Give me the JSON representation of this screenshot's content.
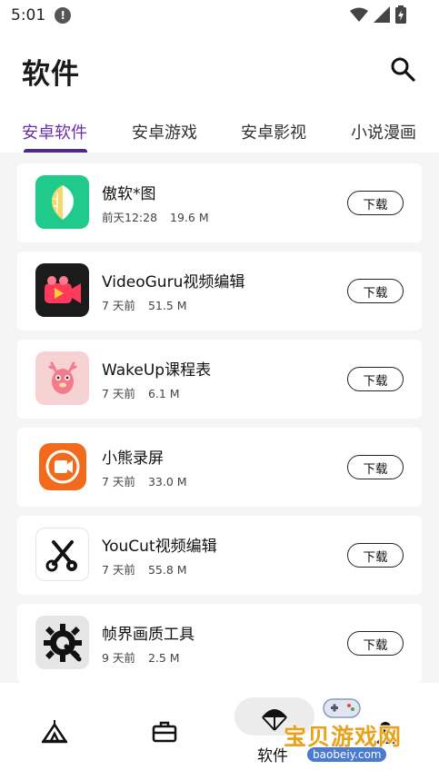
{
  "status_bar": {
    "time": "5:01",
    "info_glyph": "!"
  },
  "header": {
    "title": "软件",
    "search_icon": "search-icon"
  },
  "tabs": [
    {
      "label": "安卓软件",
      "active": true
    },
    {
      "label": "安卓游戏",
      "active": false
    },
    {
      "label": "安卓影视",
      "active": false
    },
    {
      "label": "小说漫画",
      "active": false
    }
  ],
  "apps": [
    {
      "name": "傲软*图",
      "time": "前天12:28",
      "size": "19.6 M",
      "button": "下载",
      "icon": "aoruan-leaf-icon"
    },
    {
      "name": "VideoGuru视频编辑",
      "time": "7 天前",
      "size": "51.5 M",
      "button": "下载",
      "icon": "videoguru-camera-icon"
    },
    {
      "name": "WakeUp课程表",
      "time": "7 天前",
      "size": "6.1 M",
      "button": "下载",
      "icon": "wakeup-deer-icon"
    },
    {
      "name": "小熊录屏",
      "time": "7 天前",
      "size": "33.0 M",
      "button": "下载",
      "icon": "xiaoxiong-record-icon"
    },
    {
      "name": "YouCut视频编辑",
      "time": "7 天前",
      "size": "55.8 M",
      "button": "下载",
      "icon": "youcut-scissors-icon"
    },
    {
      "name": "帧界画质工具",
      "time": "9 天前",
      "size": "2.5 M",
      "button": "下载",
      "icon": "gear-wrench-icon"
    }
  ],
  "bottom_nav": {
    "active_label": "软件",
    "items": [
      "tent-icon",
      "briefcase-icon",
      "parachute-icon",
      "profile-icon"
    ]
  },
  "watermark": {
    "text": "宝贝游戏网",
    "url": "baobeiy.com"
  },
  "colors": {
    "accent": "#6a2ea8",
    "underline": "#4b2a8a",
    "list_bg": "#f5f5f5"
  }
}
